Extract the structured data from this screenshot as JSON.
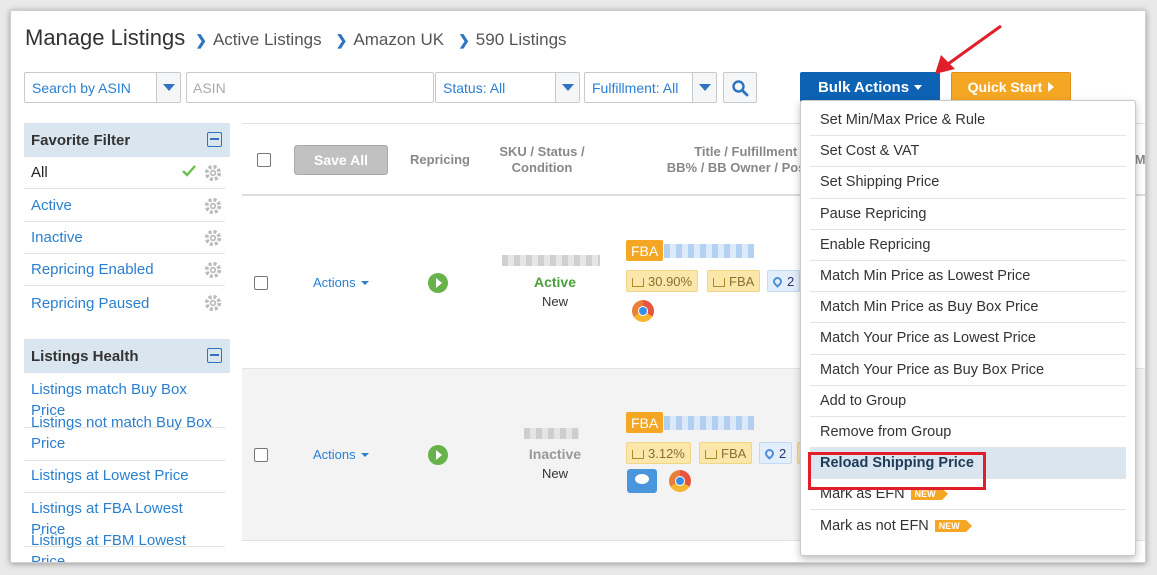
{
  "header": {
    "title": "Manage Listings",
    "breadcrumbs": [
      "Active Listings",
      "Amazon UK",
      "590 Listings"
    ]
  },
  "filters": {
    "search_by": "Search by ASIN",
    "asin_placeholder": "ASIN",
    "status": "Status: All",
    "fulfillment": "Fulfillment: All"
  },
  "buttons": {
    "bulk_actions": "Bulk Actions",
    "quick_start": "Quick Start",
    "save_all": "Save All"
  },
  "favorite_filter": {
    "title": "Favorite Filter",
    "items": [
      "All",
      "Active",
      "Inactive",
      "Repricing Enabled",
      "Repricing Paused"
    ]
  },
  "listings_health": {
    "title": "Listings Health",
    "items": [
      "Listings match Buy Box Price",
      "Listings not match Buy Box Price",
      "Listings at Lowest Price",
      "Listings at FBA Lowest Price",
      "Listings at FBM Lowest Price"
    ]
  },
  "table": {
    "headers": {
      "repricing": "Repricing",
      "sku_line1": "SKU / Status /",
      "sku_line2": "Condition",
      "title_line1": "Title / Fulfillment / A",
      "title_line2": "BB% / BB Owner / Positi",
      "cut_right": "Mi"
    },
    "rows": [
      {
        "actions": "Actions",
        "status": "Active",
        "condition": "New",
        "fba": "FBA",
        "bb_percent": "30.90%",
        "fulfillment": "FBA",
        "offers": "2"
      },
      {
        "actions": "Actions",
        "status": "Inactive",
        "condition": "New",
        "fba": "FBA",
        "bb_percent": "3.12%",
        "fulfillment": "FBA",
        "offers": "2"
      }
    ]
  },
  "bulk_menu": {
    "items": [
      "Set Min/Max Price & Rule",
      "Set Cost & VAT",
      "Set Shipping Price",
      "Pause Repricing",
      "Enable Repricing",
      "Match Min Price as Lowest Price",
      "Match Min Price as Buy Box Price",
      "Match Your Price as Lowest Price",
      "Match Your Price as Buy Box Price",
      "Add to Group",
      "Remove from Group",
      "Reload Shipping Price",
      "Mark as EFN",
      "Mark as not EFN"
    ],
    "new_badge": "NEW"
  },
  "colors": {
    "accent": "#0d62b4",
    "link": "#2a7fd0",
    "active": "#4aa03a",
    "inactive": "#999999",
    "orange": "#f5a623",
    "highlight": "#e01f2b"
  }
}
